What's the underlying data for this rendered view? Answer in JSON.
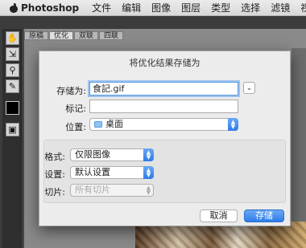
{
  "menubar": {
    "app_name": "Photoshop",
    "items": [
      "文件",
      "编辑",
      "图像",
      "图层",
      "类型",
      "选择",
      "滤镜",
      "视图"
    ]
  },
  "document": {
    "tabs": [
      "原稿",
      "优化",
      "双联",
      "四联"
    ]
  },
  "dialog": {
    "title": "将优化结果存储为",
    "save_as_label": "存储为:",
    "save_as_value": "食記.gif",
    "tags_label": "标记:",
    "tags_value": "",
    "location_label": "位置:",
    "location_value": "桌面",
    "format_label": "格式:",
    "format_value": "仅限图像",
    "settings_label": "设置:",
    "settings_value": "默认设置",
    "slices_label": "切片:",
    "slices_value": "所有切片",
    "cancel_label": "取消",
    "save_label": "存储"
  },
  "colors": {
    "accent": "#2e7ce8",
    "focus_ring": "#9cc3f0"
  }
}
